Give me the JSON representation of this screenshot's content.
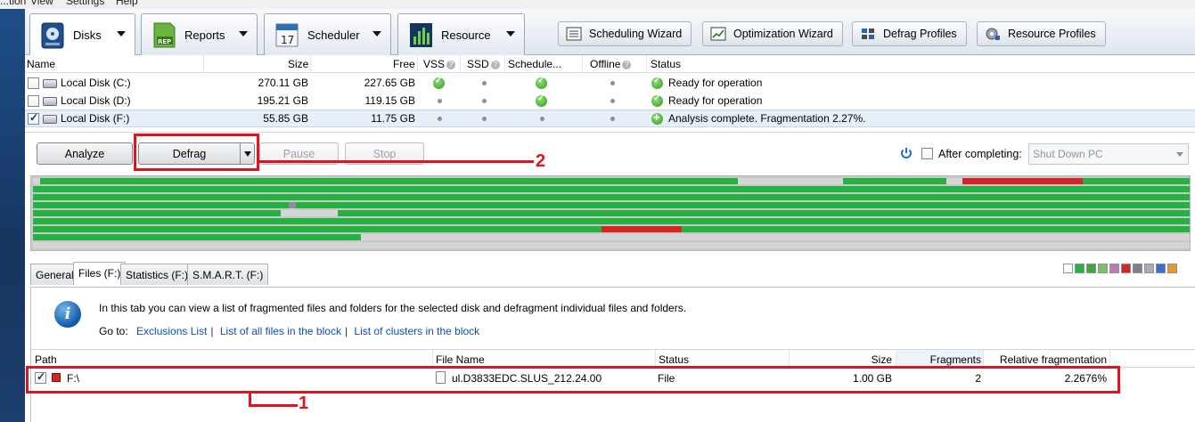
{
  "menu": [
    "...tion",
    "View",
    "Settings",
    "Help"
  ],
  "toolbar": {
    "tabs": [
      {
        "label": "Disks",
        "icon": "disk-icon"
      },
      {
        "label": "Reports",
        "icon": "report-icon"
      },
      {
        "label": "Scheduler",
        "icon": "calendar-icon"
      },
      {
        "label": "Resource",
        "icon": "resource-chart-icon"
      }
    ],
    "scheduler_day": "17",
    "report_badge": "REP",
    "wizards": [
      {
        "label": "Scheduling Wizard",
        "icon": "scheduling-wizard-icon"
      },
      {
        "label": "Optimization Wizard",
        "icon": "optimization-wizard-icon"
      },
      {
        "label": "Defrag Profiles",
        "icon": "defrag-profiles-icon"
      },
      {
        "label": "Resource Profiles",
        "icon": "resource-profiles-icon"
      }
    ]
  },
  "disks": {
    "columns": {
      "name": "Name",
      "size": "Size",
      "free": "Free",
      "vss": "VSS",
      "ssd": "SSD",
      "schedule": "Schedule...",
      "offline": "Offline",
      "status": "Status"
    },
    "help_mark": "?",
    "rows": [
      {
        "name": "Local Disk (C:)",
        "size": "270.11 GB",
        "free": "227.65 GB",
        "checked": false,
        "status": "Ready for operation"
      },
      {
        "name": "Local Disk (D:)",
        "size": "195.21 GB",
        "free": "119.15 GB",
        "checked": false,
        "status": "Ready for operation"
      },
      {
        "name": "Local Disk (F:)",
        "size": "55.85 GB",
        "free": "11.75 GB",
        "checked": true,
        "status": "Analysis complete. Fragmentation 2.27%."
      }
    ]
  },
  "actions": {
    "analyze": "Analyze",
    "defrag": "Defrag",
    "pause": "Pause",
    "stop": "Stop",
    "after_completing": "After completing:",
    "after_option": "Shut Down PC"
  },
  "callouts": {
    "one": "1",
    "two": "2"
  },
  "tabs": [
    "General",
    "Files (F:)",
    "Statistics (F:)",
    "S.M.A.R.T. (F:)"
  ],
  "legend_colors": [
    "#ffffff",
    "#26b241",
    "#3fa83a",
    "#7fbf6a",
    "#c07ab8",
    "#d62525",
    "#7e8287",
    "#a9adb2",
    "#3a6fd1",
    "#e59a2b"
  ],
  "info": {
    "text": "In this tab you can view a list of fragmented files and folders for the selected disk and defragment individual files and folders.",
    "goto": "Go to:",
    "links": [
      "Exclusions List",
      "List of all files in the block",
      "List of clusters in the block"
    ],
    "separator": "|",
    "icon_glyph": "i"
  },
  "files": {
    "columns": {
      "path": "Path",
      "file_name": "File Name",
      "status": "Status",
      "size": "Size",
      "fragments": "Fragments",
      "relative": "Relative fragmentation"
    },
    "rows": [
      {
        "path": "F:\\",
        "file_name": "ul.D3833EDC.SLUS_212.24.00",
        "status": "File",
        "size": "1.00 GB",
        "fragments": "2",
        "relative": "2.2676%",
        "checked": true
      }
    ]
  }
}
